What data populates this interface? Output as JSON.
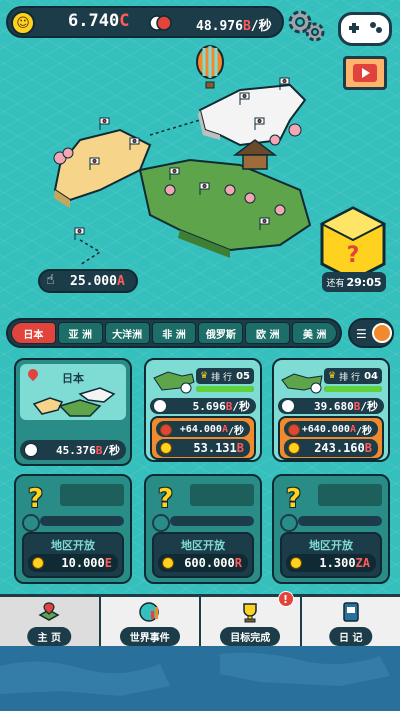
{
  "header": {
    "money_value": "6.740",
    "money_unit": "C",
    "rate_value": "48.976",
    "rate_unit": "B",
    "rate_suffix": "/秒"
  },
  "map": {
    "tap_value": "25.000",
    "tap_unit": "A",
    "timer_prefix": "还有",
    "timer_value": "29:05"
  },
  "region_tabs": [
    {
      "label": "日本"
    },
    {
      "label": "亚 洲"
    },
    {
      "label": "大洋洲"
    },
    {
      "label": "非 洲"
    },
    {
      "label": "俄罗斯"
    },
    {
      "label": "欧 洲"
    },
    {
      "label": "美 洲"
    }
  ],
  "main_card": {
    "title": "日本",
    "income_value": "45.376",
    "income_unit": "B",
    "income_suffix": "/秒"
  },
  "country_cards": [
    {
      "rank_label": "排 行",
      "rank": "05",
      "progress": 1.0,
      "rate_value": "5.696",
      "rate_unit": "B",
      "rate_suffix": "/秒",
      "plus_value": "+64.000",
      "plus_unit": "A",
      "plus_suffix": "/秒",
      "cost_value": "53.131",
      "cost_unit": "B"
    },
    {
      "rank_label": "排 行",
      "rank": "04",
      "progress": 1.0,
      "rate_value": "39.680",
      "rate_unit": "B",
      "rate_suffix": "/秒",
      "plus_value": "+640.000",
      "plus_unit": "A",
      "plus_suffix": "/秒",
      "cost_value": "243.160",
      "cost_unit": "B"
    }
  ],
  "locked_cards": [
    {
      "unlock_label": "地区开放",
      "price_value": "10.000",
      "price_unit": "E"
    },
    {
      "unlock_label": "地区开放",
      "price_value": "600.000",
      "price_unit": "R"
    },
    {
      "unlock_label": "地区开放",
      "price_value": "1.300",
      "price_unit": "ZA"
    }
  ],
  "nav": [
    {
      "label": "主 页"
    },
    {
      "label": "世界事件"
    },
    {
      "label": "目标完成",
      "badge": "!"
    },
    {
      "label": "日 记"
    }
  ],
  "colors": {
    "accent_red": "#e2443b",
    "panel_dark": "#1c3c49",
    "teal_bg": "#36c0bd"
  }
}
